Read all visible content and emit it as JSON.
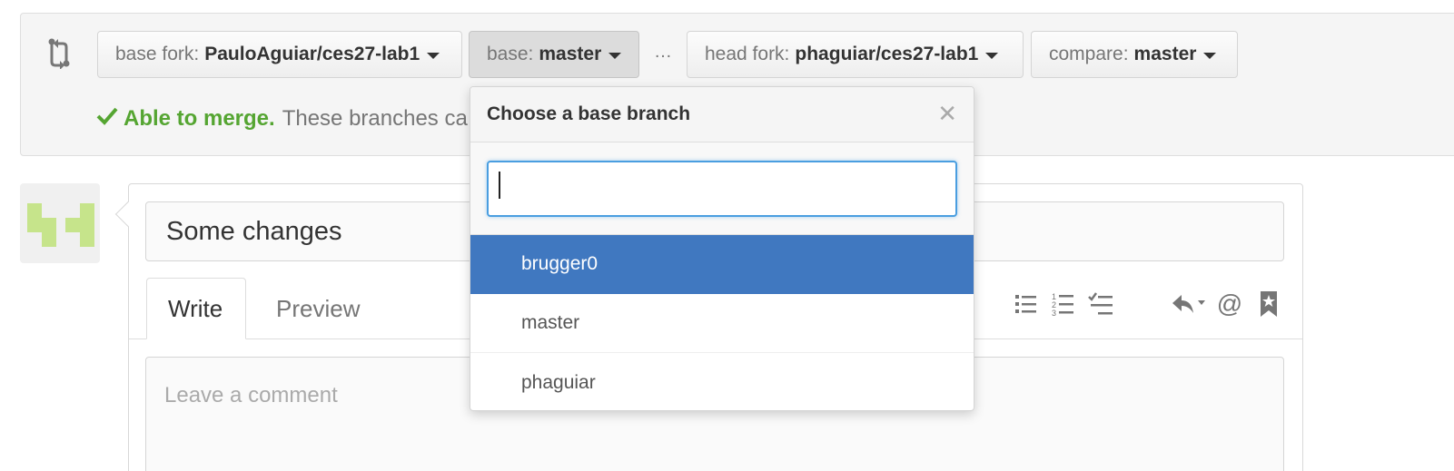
{
  "range": {
    "base_fork": {
      "label": "base fork:",
      "value": "PauloAguiar/ces27-lab1"
    },
    "base": {
      "label": "base:",
      "value": "master"
    },
    "separator": "…",
    "head_fork": {
      "label": "head fork:",
      "value": "phaguiar/ces27-lab1"
    },
    "compare": {
      "label": "compare:",
      "value": "master"
    }
  },
  "merge_status": {
    "ok_label": "Able to merge.",
    "message": "These branches ca"
  },
  "pull_request": {
    "title_value": "Some changes",
    "tabs": [
      {
        "label": "Write"
      },
      {
        "label": "Preview"
      }
    ],
    "comment_placeholder": "Leave a comment"
  },
  "toolbar": {
    "icons": [
      "unordered-list-icon",
      "ordered-list-icon",
      "task-list-icon",
      "reply-icon",
      "mention-icon",
      "reference-icon"
    ]
  },
  "dropdown": {
    "title": "Choose a base branch",
    "filter_value": "",
    "items": [
      {
        "label": "brugger0",
        "selected": true
      },
      {
        "label": "master",
        "selected": false
      },
      {
        "label": "phaguiar",
        "selected": false
      }
    ]
  },
  "colors": {
    "accent_blue": "#4078c0",
    "success_green": "#55a532",
    "focus_blue": "#4a9ee0",
    "avatar_green": "#c6e48b"
  }
}
